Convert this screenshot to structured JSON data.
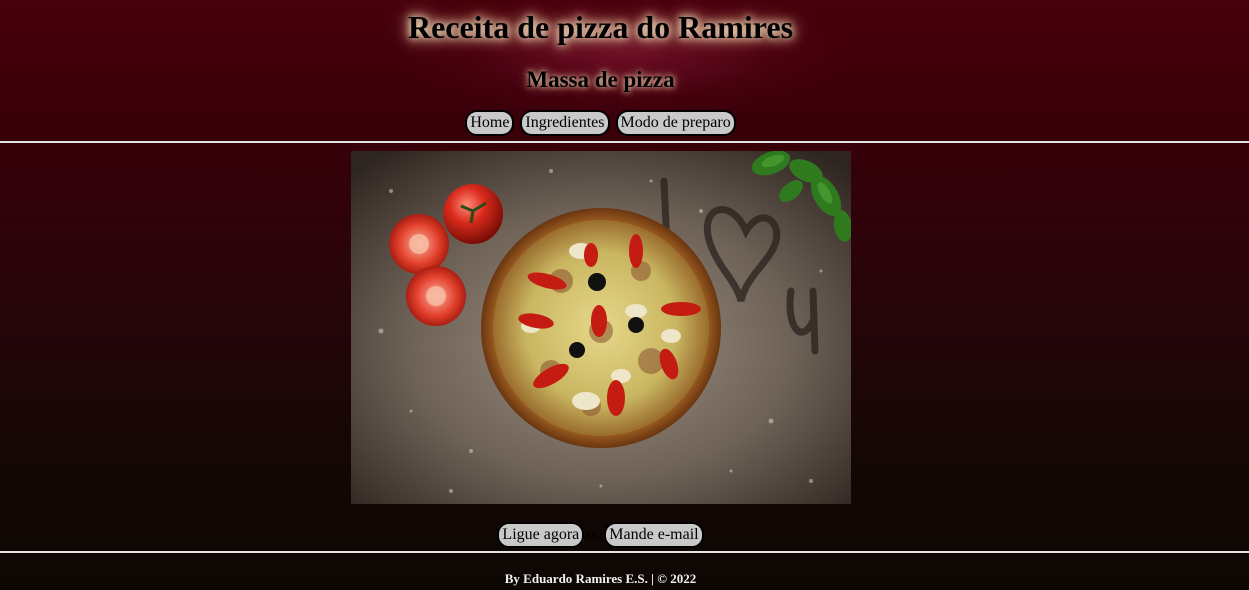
{
  "header": {
    "title": "Receita de pizza do Ramires",
    "subtitle": "Massa de pizza"
  },
  "nav": {
    "items": [
      {
        "label": "Home"
      },
      {
        "label": "Ingredientes"
      },
      {
        "label": "Modo de preparo"
      }
    ]
  },
  "hero": {
    "alt": "Pizza sobre farinha com tomates e manjericão"
  },
  "contact": {
    "call_label": "Ligue agora",
    "separator": "ou",
    "email_label": "Mande e-mail"
  },
  "footer": {
    "text": "By Eduardo Ramires E.S. | © 2022"
  },
  "colors": {
    "background_top": "#47000d",
    "background_bottom": "#0d0703",
    "button_bg": "#c9c9c9",
    "rule": "#e6e0e2"
  }
}
